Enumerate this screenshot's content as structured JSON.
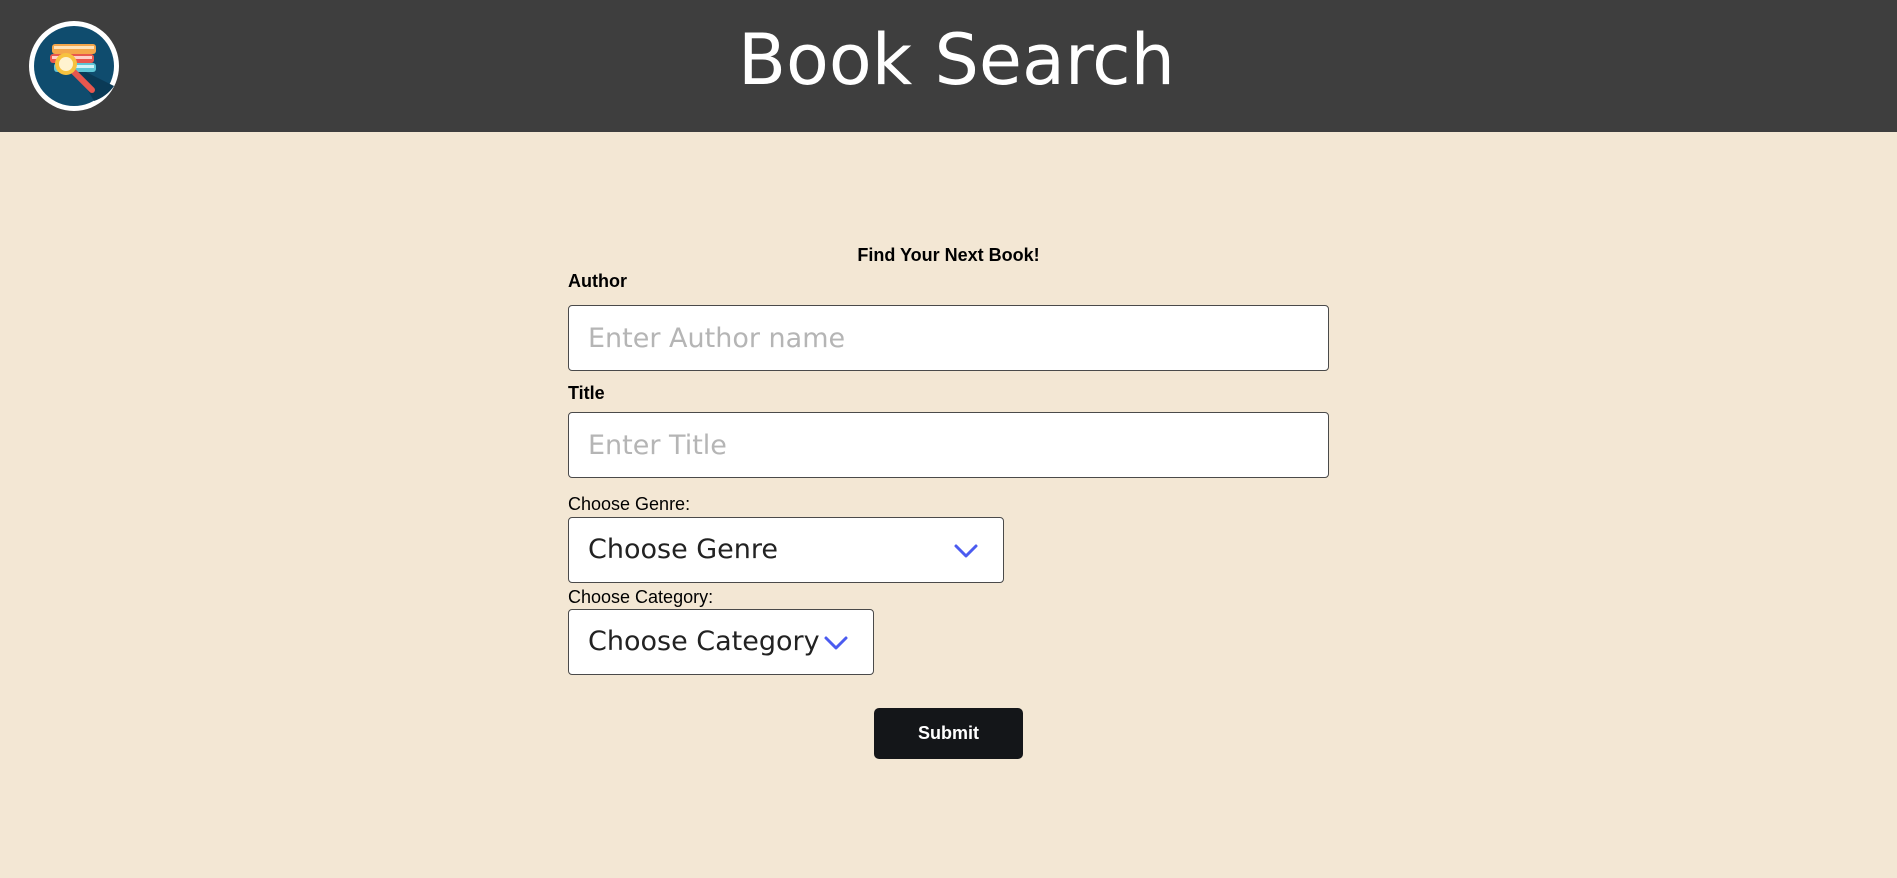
{
  "header": {
    "title": "Book Search",
    "logo_icon": "book-search-logo-icon"
  },
  "form": {
    "heading": "Find Your Next Book!",
    "author": {
      "label": "Author",
      "placeholder": "Enter Author name",
      "value": ""
    },
    "title": {
      "label": "Title",
      "placeholder": "Enter Title",
      "value": ""
    },
    "genre": {
      "label": "Choose Genre:",
      "selected": "Choose Genre"
    },
    "category": {
      "label": "Choose Category:",
      "selected": "Choose Category"
    },
    "submit_label": "Submit"
  },
  "colors": {
    "header_bg": "#3e3e3e",
    "page_bg": "#f3e7d4",
    "button_bg": "#141619",
    "chevron": "#4b5bf0"
  }
}
